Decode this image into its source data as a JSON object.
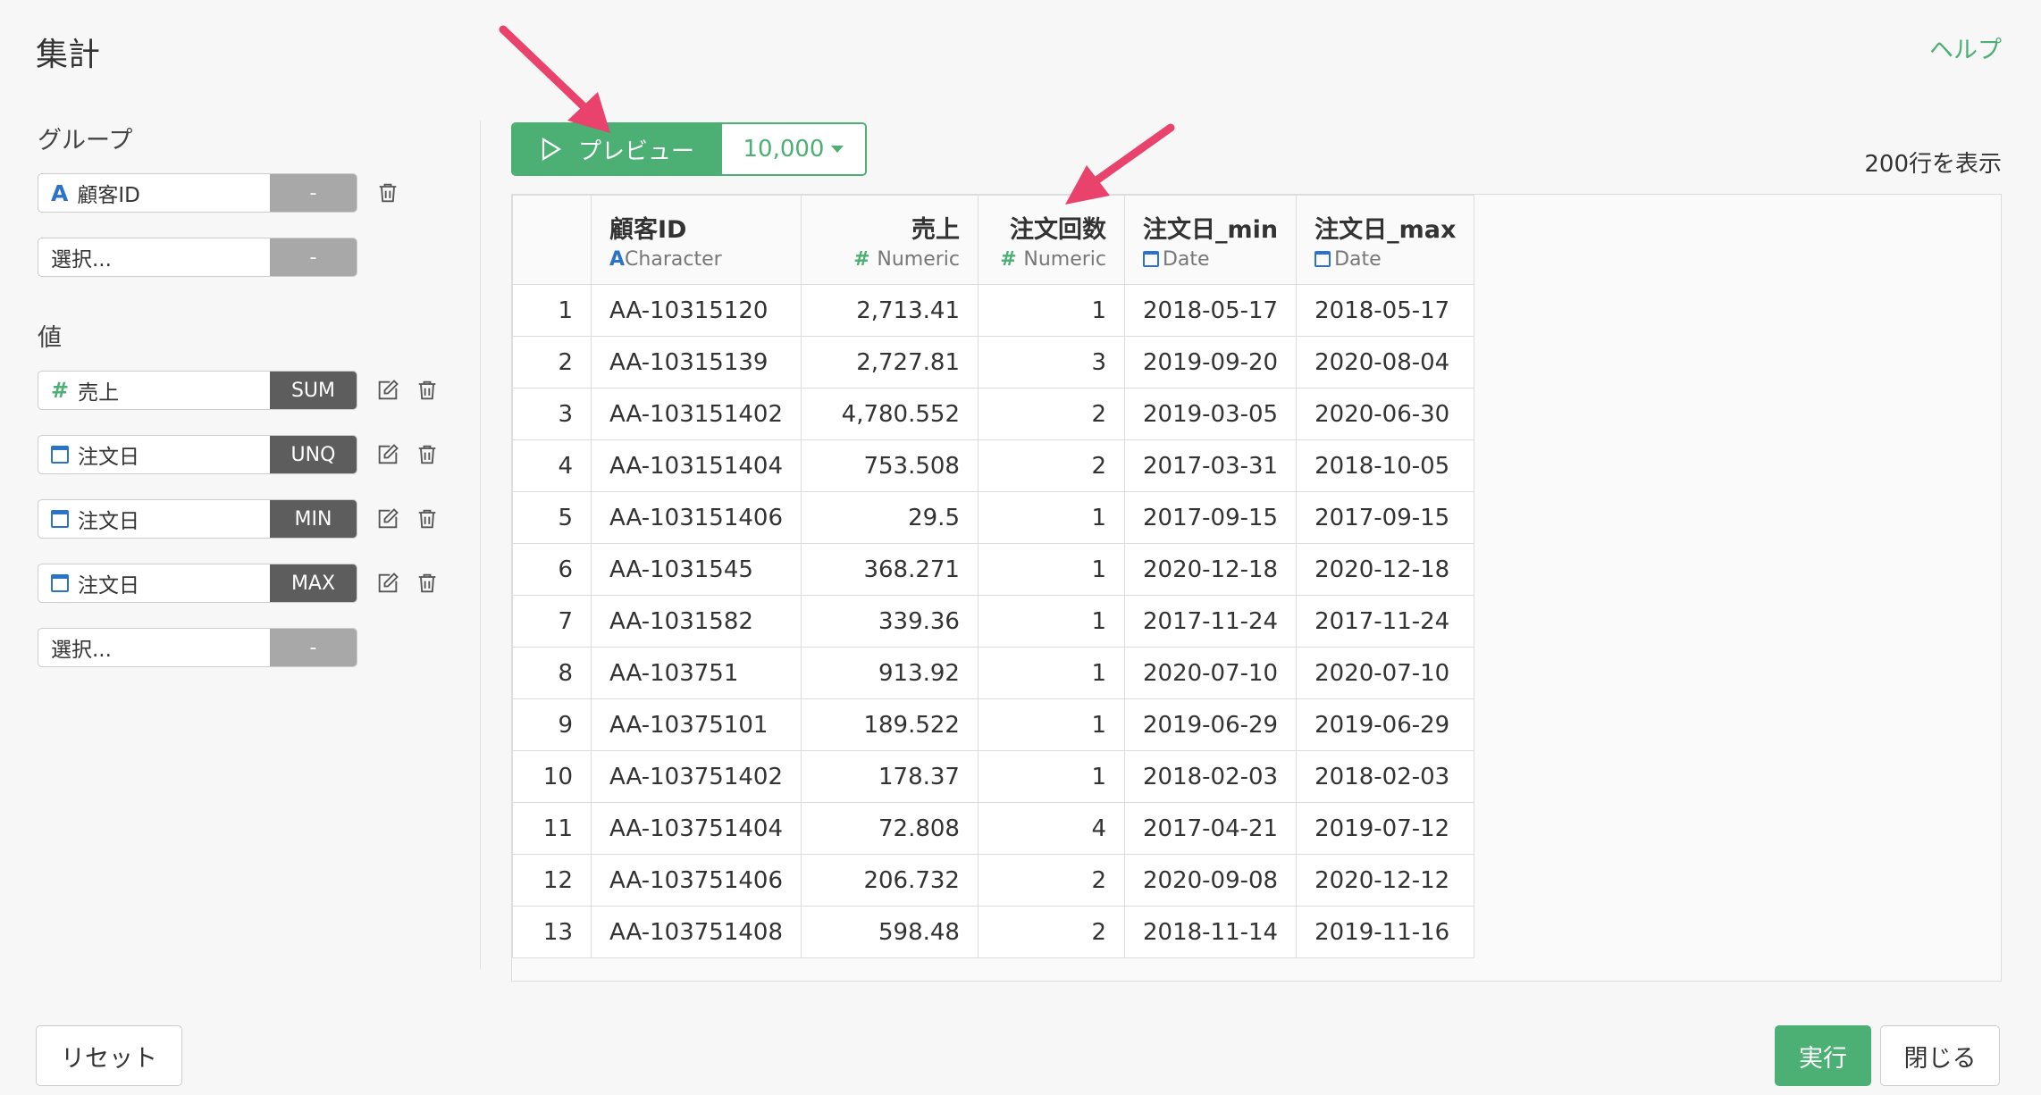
{
  "header": {
    "title": "集計",
    "help": "ヘルプ"
  },
  "group": {
    "label": "グループ",
    "items": [
      {
        "icon": "character-icon",
        "name": "顧客ID",
        "func": "-"
      },
      {
        "icon": "",
        "name": "選択...",
        "func": "-"
      }
    ]
  },
  "values": {
    "label": "値",
    "items": [
      {
        "icon": "numeric-icon",
        "name": "売上",
        "func": "SUM"
      },
      {
        "icon": "date-icon",
        "name": "注文日",
        "func": "UNQ"
      },
      {
        "icon": "date-icon",
        "name": "注文日",
        "func": "MIN"
      },
      {
        "icon": "date-icon",
        "name": "注文日",
        "func": "MAX"
      },
      {
        "icon": "",
        "name": "選択...",
        "func": "-"
      }
    ]
  },
  "preview": {
    "label": "プレビュー",
    "count": "10,000",
    "row_count": "200行を表示"
  },
  "table": {
    "columns": [
      {
        "name": "顧客ID",
        "type": "Character",
        "type_icon": "character-icon"
      },
      {
        "name": "売上",
        "type": "Numeric",
        "type_icon": "numeric-icon"
      },
      {
        "name": "注文回数",
        "type": "Numeric",
        "type_icon": "numeric-icon"
      },
      {
        "name": "注文日_min",
        "type": "Date",
        "type_icon": "date-icon"
      },
      {
        "name": "注文日_max",
        "type": "Date",
        "type_icon": "date-icon"
      }
    ],
    "rows": [
      [
        "1",
        "AA-10315120",
        "2,713.41",
        "1",
        "2018-05-17",
        "2018-05-17"
      ],
      [
        "2",
        "AA-10315139",
        "2,727.81",
        "3",
        "2019-09-20",
        "2020-08-04"
      ],
      [
        "3",
        "AA-103151402",
        "4,780.552",
        "2",
        "2019-03-05",
        "2020-06-30"
      ],
      [
        "4",
        "AA-103151404",
        "753.508",
        "2",
        "2017-03-31",
        "2018-10-05"
      ],
      [
        "5",
        "AA-103151406",
        "29.5",
        "1",
        "2017-09-15",
        "2017-09-15"
      ],
      [
        "6",
        "AA-1031545",
        "368.271",
        "1",
        "2020-12-18",
        "2020-12-18"
      ],
      [
        "7",
        "AA-1031582",
        "339.36",
        "1",
        "2017-11-24",
        "2017-11-24"
      ],
      [
        "8",
        "AA-103751",
        "913.92",
        "1",
        "2020-07-10",
        "2020-07-10"
      ],
      [
        "9",
        "AA-10375101",
        "189.522",
        "1",
        "2019-06-29",
        "2019-06-29"
      ],
      [
        "10",
        "AA-103751402",
        "178.37",
        "1",
        "2018-02-03",
        "2018-02-03"
      ],
      [
        "11",
        "AA-103751404",
        "72.808",
        "4",
        "2017-04-21",
        "2019-07-12"
      ],
      [
        "12",
        "AA-103751406",
        "206.732",
        "2",
        "2020-09-08",
        "2020-12-12"
      ],
      [
        "13",
        "AA-103751408",
        "598.48",
        "2",
        "2018-11-14",
        "2019-11-16"
      ]
    ]
  },
  "footer": {
    "reset": "リセット",
    "run": "実行",
    "close": "閉じる"
  },
  "colors": {
    "accent": "#4caf73",
    "arrow": "#e8426d",
    "type_blue": "#2a73c9"
  }
}
